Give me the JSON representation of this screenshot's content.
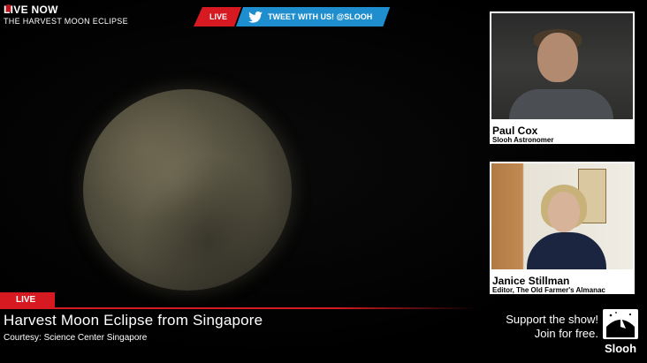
{
  "header": {
    "live_now": "LIVE NOW",
    "show_title": "THE HARVEST MOON ECLIPSE"
  },
  "tweet_bar": {
    "live_label": "LIVE",
    "tweet_label": "TWEET WITH US! @SLOOH",
    "icon": "twitter-icon"
  },
  "panels": [
    {
      "name": "Paul Cox",
      "role": "Slooh Astronomer"
    },
    {
      "name": "Janice Stillman",
      "role": "Editor, The Old Farmer's Almanac"
    }
  ],
  "lower_third": {
    "live_label": "LIVE",
    "title": "Harvest Moon Eclipse from Singapore",
    "credit": "Courtesy: Science Center Singapore"
  },
  "promo": {
    "line1": "Support the show!",
    "line2": "Join for free.",
    "brand": "Slooh"
  },
  "colors": {
    "accent_red": "#d71a21",
    "twitter_blue": "#1e8ecf"
  }
}
